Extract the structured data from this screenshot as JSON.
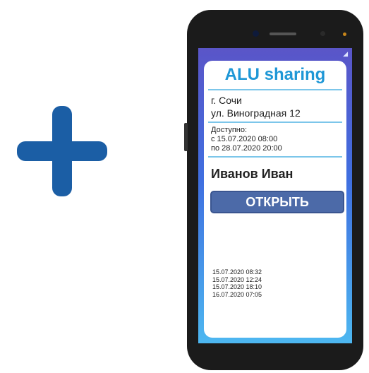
{
  "app": {
    "title": "ALU sharing",
    "city": "г. Сочи",
    "street": "ул. Виноградная 12",
    "availability_label": "Доступно:",
    "available_from": "с   15.07.2020 08:00",
    "available_to": "по 28.07.2020 20:00",
    "user_name": "Иванов Иван",
    "open_button_label": "ОТКРЫТЬ",
    "access_log": [
      "15.07.2020 08:32",
      "15.07.2020 12:24",
      "15.07.2020 18:10",
      "16.07.2020 07:05"
    ]
  },
  "colors": {
    "plus": "#1b5ea5",
    "title": "#1e97d6",
    "button": "#4c6aa8",
    "screen_top": "#5a55c8",
    "screen_bottom": "#4db7f0"
  },
  "icons": {
    "plus": "plus-icon",
    "signal": "signal-icon"
  }
}
